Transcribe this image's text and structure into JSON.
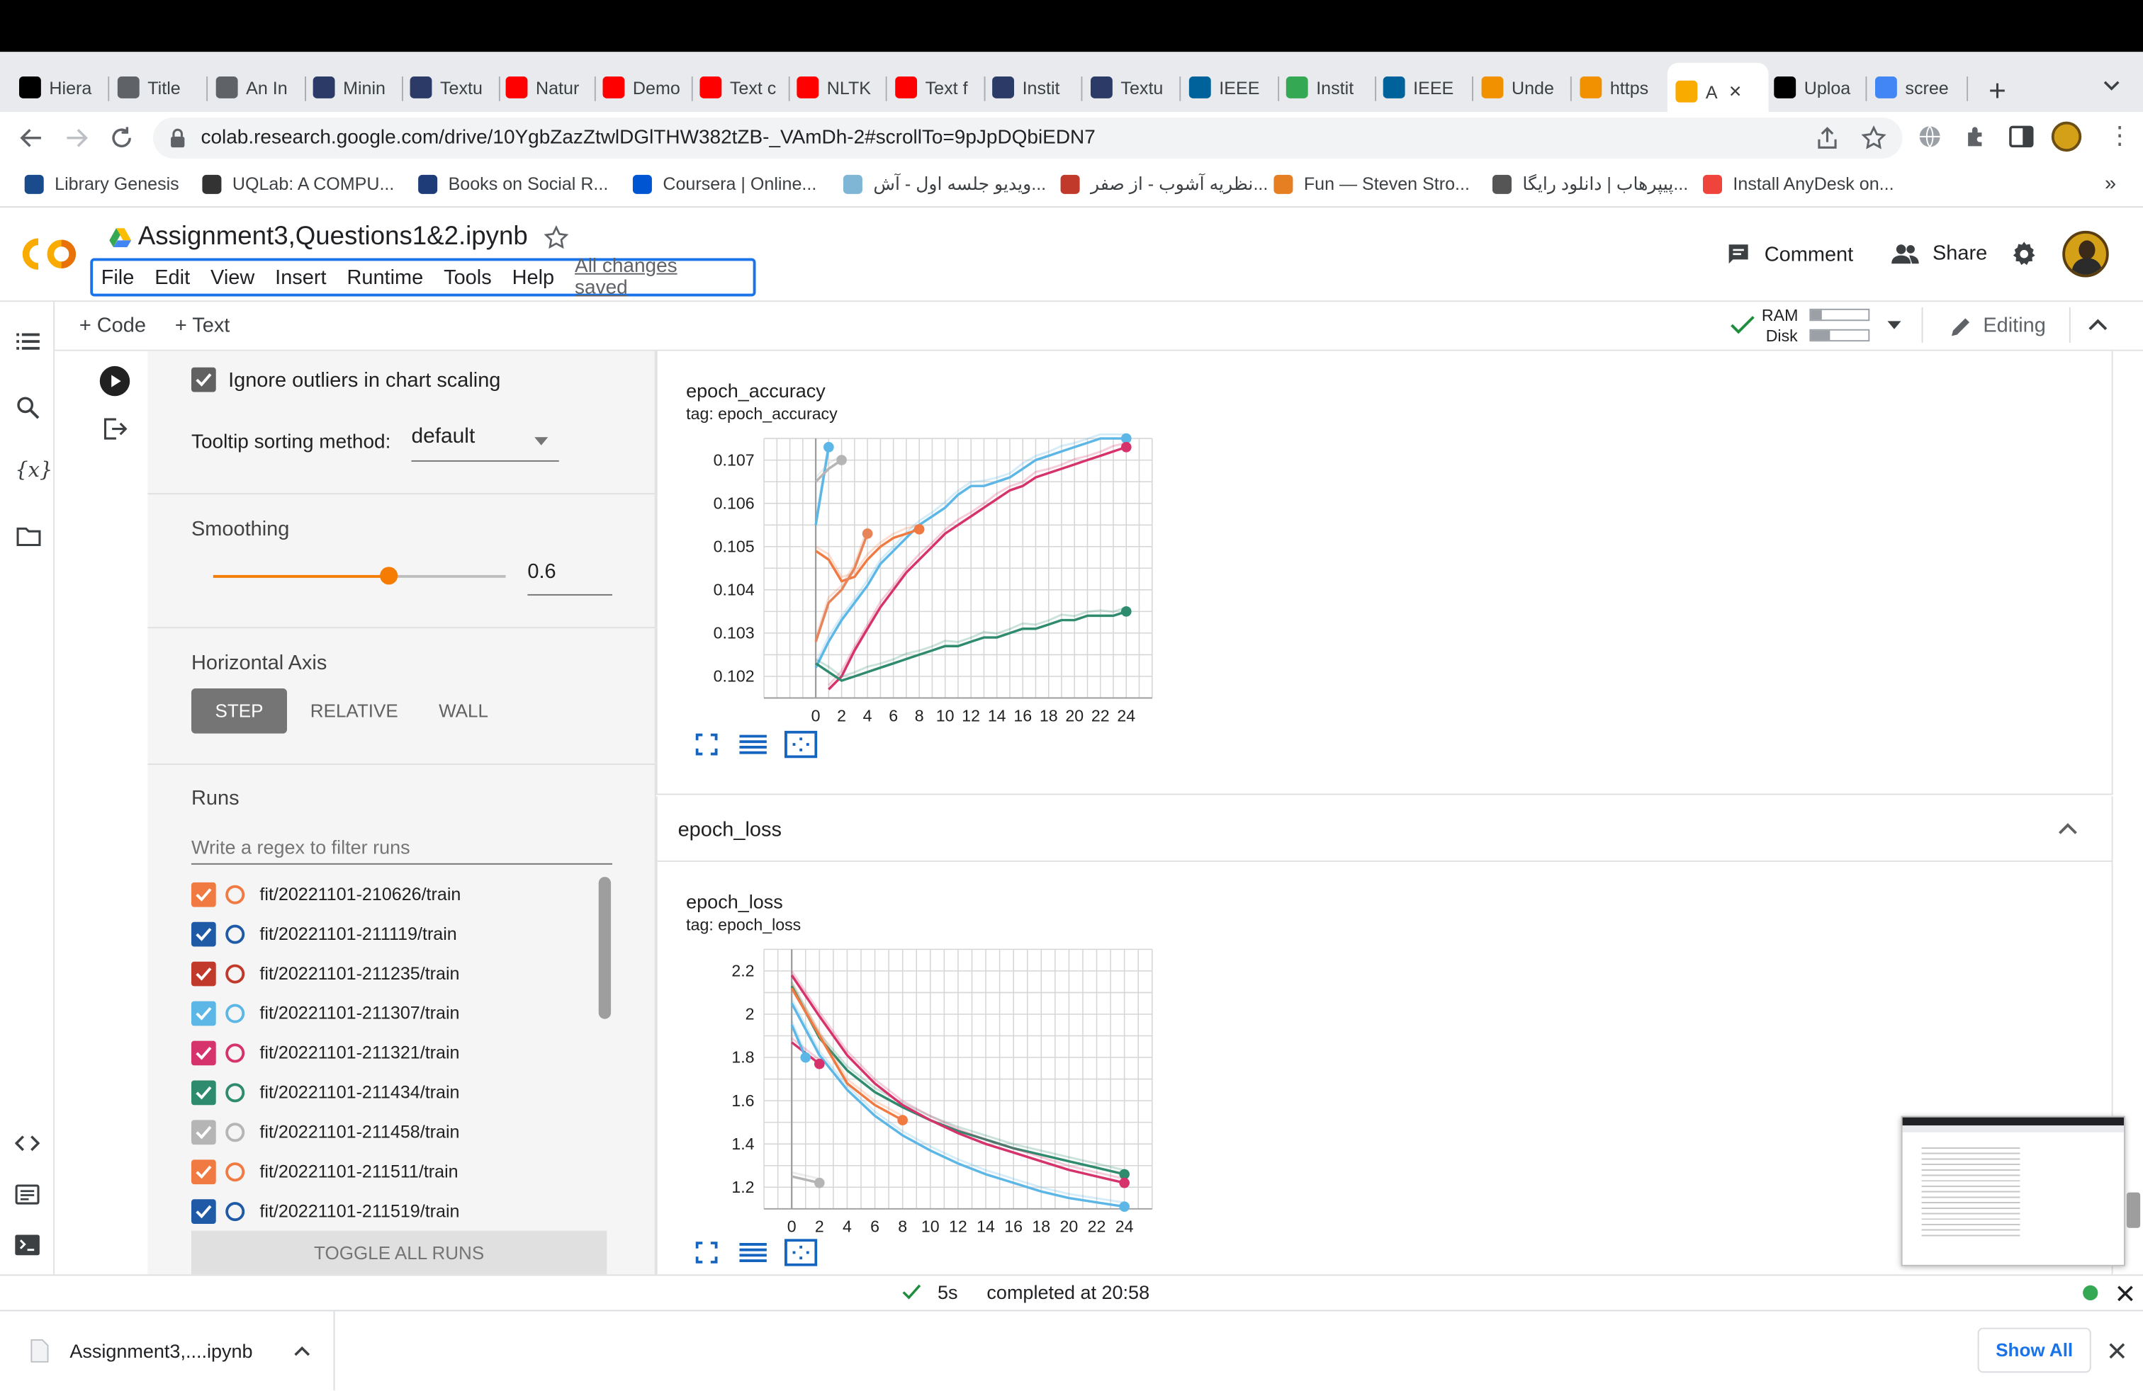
{
  "browser": {
    "tabs": [
      {
        "label": "Hiera",
        "icon": "asu-icon",
        "color": "#000"
      },
      {
        "label": "Title",
        "icon": "globe-icon",
        "color": "#5f6368"
      },
      {
        "label": "An In",
        "icon": "globe-icon",
        "color": "#5f6368"
      },
      {
        "label": "Minin",
        "icon": "arc-icon",
        "color": "#2b3a67"
      },
      {
        "label": "Textu",
        "icon": "arc-icon",
        "color": "#2b3a67"
      },
      {
        "label": "Natur",
        "icon": "youtube-icon",
        "color": "#ff0000"
      },
      {
        "label": "Demo",
        "icon": "youtube-icon",
        "color": "#ff0000"
      },
      {
        "label": "Text c",
        "icon": "youtube-icon",
        "color": "#ff0000"
      },
      {
        "label": "NLTK",
        "icon": "youtube-icon",
        "color": "#ff0000"
      },
      {
        "label": "Text f",
        "icon": "youtube-icon",
        "color": "#ff0000"
      },
      {
        "label": "Instit",
        "icon": "arc-icon",
        "color": "#2b3a67"
      },
      {
        "label": "Textu",
        "icon": "arc-icon",
        "color": "#2b3a67"
      },
      {
        "label": "IEEE",
        "icon": "ieee-icon",
        "color": "#00629b"
      },
      {
        "label": "Instit",
        "icon": "chrome-icon",
        "color": "#34a853"
      },
      {
        "label": "IEEE",
        "icon": "ieee-icon",
        "color": "#00629b"
      },
      {
        "label": "Unde",
        "icon": "e-icon",
        "color": "#f29100"
      },
      {
        "label": "https",
        "icon": "e-icon",
        "color": "#f29100"
      },
      {
        "label": "A",
        "icon": "colab-icon",
        "color": "#f9ab00",
        "active": true
      },
      {
        "label": "Uploa",
        "icon": "github-icon",
        "color": "#000"
      },
      {
        "label": "scree",
        "icon": "google-icon",
        "color": "#4285f4"
      }
    ],
    "url": "colab.research.google.com/drive/10YgbZazZtwlDGlTHW382tZB-_VAmDh-2#scrollTo=9pJpDQbiEDN7",
    "bookmarks": [
      {
        "label": "Library Genesis",
        "color": "#1a4b8c"
      },
      {
        "label": "UQLab: A COMPU...",
        "color": "#333"
      },
      {
        "label": "Books on Social R...",
        "color": "#1d3c78"
      },
      {
        "label": "Coursera | Online...",
        "color": "#0056d2"
      },
      {
        "label": "ویدیو جلسه اول - آش...",
        "color": "#7fb6d6"
      },
      {
        "label": "نظریه آشوب - از صفر...",
        "color": "#c0392b"
      },
      {
        "label": "Fun — Steven Stro...",
        "color": "#e67e22"
      },
      {
        "label": "پیپرهاب | دانلود رایگا...",
        "color": "#555"
      },
      {
        "label": "Install AnyDesk on...",
        "color": "#ef443b"
      }
    ],
    "more_bookmarks": "»"
  },
  "colab": {
    "notebook_title": "Assignment3,Questions1&2.ipynb",
    "menu": [
      "File",
      "Edit",
      "View",
      "Insert",
      "Runtime",
      "Tools",
      "Help"
    ],
    "saved_status": "All changes saved",
    "comment_label": "Comment",
    "share_label": "Share",
    "add_code": "+ Code",
    "add_text": "+ Text",
    "ram_label": "RAM",
    "disk_label": "Disk",
    "editing_label": "Editing",
    "status_time": "5s",
    "status_text": "completed at 20:58"
  },
  "tensorboard": {
    "ignore_outliers_label": "Ignore outliers in chart scaling",
    "ignore_outliers_checked": true,
    "tooltip_sort_label": "Tooltip sorting method:",
    "tooltip_sort_value": "default",
    "smoothing_label": "Smoothing",
    "smoothing_value": "0.6",
    "smoothing_fraction": 0.6,
    "horizontal_axis_label": "Horizontal Axis",
    "axis_options": [
      "STEP",
      "RELATIVE",
      "WALL"
    ],
    "axis_selected": "STEP",
    "runs_label": "Runs",
    "runs_filter_placeholder": "Write a regex to filter runs",
    "toggle_all_label": "TOGGLE ALL RUNS",
    "runs": [
      {
        "name": "fit/20221101-210626/train",
        "color": "#f07a42"
      },
      {
        "name": "fit/20221101-211119/train",
        "color": "#1f5aa6"
      },
      {
        "name": "fit/20221101-211235/train",
        "color": "#c0392b"
      },
      {
        "name": "fit/20221101-211307/train",
        "color": "#5cb7e6"
      },
      {
        "name": "fit/20221101-211321/train",
        "color": "#d6336c"
      },
      {
        "name": "fit/20221101-211434/train",
        "color": "#2e8b6e"
      },
      {
        "name": "fit/20221101-211458/train",
        "color": "#b5b5b5"
      },
      {
        "name": "fit/20221101-211511/train",
        "color": "#f07a42"
      },
      {
        "name": "fit/20221101-211519/train",
        "color": "#1f5aa6"
      }
    ],
    "loss_section_header": "epoch_loss"
  },
  "downloads": {
    "file_name": "Assignment3,....ipynb",
    "show_all": "Show All"
  },
  "chart_data": [
    {
      "type": "line",
      "title": "epoch_accuracy",
      "subtitle": "tag: epoch_accuracy",
      "xticks": [
        0,
        2,
        4,
        6,
        8,
        10,
        12,
        14,
        16,
        18,
        20,
        22,
        24
      ],
      "yticks": [
        0.102,
        0.103,
        0.104,
        0.105,
        0.106,
        0.107
      ],
      "xlim": [
        -4,
        26
      ],
      "ylim": [
        0.1015,
        0.1075
      ],
      "grid": true,
      "series": [
        {
          "color": "#5cb7e6",
          "x": [
            0,
            1,
            2,
            3,
            4,
            5,
            6,
            7,
            8,
            9,
            10,
            11,
            12,
            13,
            14,
            15,
            16,
            17,
            18,
            19,
            20,
            21,
            22,
            23,
            24
          ],
          "y": [
            0.1022,
            0.1028,
            0.1033,
            0.1037,
            0.1041,
            0.1046,
            0.1049,
            0.1052,
            0.1055,
            0.1057,
            0.1059,
            0.1062,
            0.1064,
            0.1064,
            0.1065,
            0.1066,
            0.1068,
            0.107,
            0.1071,
            0.1072,
            0.1073,
            0.1074,
            0.1075,
            0.1076,
            0.1078
          ]
        },
        {
          "color": "#d6336c",
          "x": [
            1,
            2,
            3,
            4,
            5,
            6,
            7,
            8,
            9,
            10,
            11,
            12,
            13,
            14,
            15,
            16,
            17,
            18,
            19,
            20,
            21,
            22,
            23,
            24
          ],
          "y": [
            0.1017,
            0.102,
            0.1026,
            0.1031,
            0.1036,
            0.104,
            0.1044,
            0.1047,
            0.105,
            0.1053,
            0.1055,
            0.1057,
            0.1059,
            0.1061,
            0.1063,
            0.1064,
            0.1066,
            0.1067,
            0.1068,
            0.1069,
            0.107,
            0.1071,
            0.1072,
            0.1073
          ]
        },
        {
          "color": "#2e8b6e",
          "x": [
            0,
            1,
            2,
            3,
            4,
            5,
            6,
            7,
            8,
            9,
            10,
            11,
            12,
            13,
            14,
            15,
            16,
            17,
            18,
            19,
            20,
            21,
            22,
            23,
            24
          ],
          "y": [
            0.1023,
            0.1021,
            0.1019,
            0.102,
            0.1021,
            0.1022,
            0.1023,
            0.1024,
            0.1025,
            0.1026,
            0.1027,
            0.1027,
            0.1028,
            0.1029,
            0.1029,
            0.103,
            0.1031,
            0.1031,
            0.1032,
            0.1033,
            0.1033,
            0.1034,
            0.1034,
            0.1034,
            0.1035
          ]
        },
        {
          "color": "#f07a42",
          "x": [
            0,
            1,
            2,
            3,
            4,
            5,
            6,
            7,
            8
          ],
          "y": [
            0.1049,
            0.1047,
            0.1042,
            0.1043,
            0.1047,
            0.105,
            0.1052,
            0.1053,
            0.1054
          ]
        },
        {
          "color": "#e8845a",
          "x": [
            0,
            1,
            2,
            3,
            4
          ],
          "y": [
            0.1028,
            0.1037,
            0.104,
            0.1045,
            0.1053
          ]
        },
        {
          "color": "#5cb7e6",
          "x": [
            0,
            1
          ],
          "y": [
            0.1055,
            0.1073
          ]
        },
        {
          "color": "#b5b5b5",
          "x": [
            0,
            1,
            2
          ],
          "y": [
            0.1065,
            0.1068,
            0.107
          ]
        }
      ]
    },
    {
      "type": "line",
      "title": "epoch_loss",
      "subtitle": "tag: epoch_loss",
      "xticks": [
        0,
        2,
        4,
        6,
        8,
        10,
        12,
        14,
        16,
        18,
        20,
        22,
        24
      ],
      "yticks": [
        1.2,
        1.4,
        1.6,
        1.8,
        2,
        2.2
      ],
      "xlim": [
        -2,
        26
      ],
      "ylim": [
        1.1,
        2.3
      ],
      "grid": true,
      "series": [
        {
          "color": "#2e8b6e",
          "x": [
            0,
            2,
            4,
            6,
            8,
            10,
            12,
            14,
            16,
            18,
            20,
            22,
            24
          ],
          "y": [
            2.13,
            1.89,
            1.74,
            1.64,
            1.57,
            1.51,
            1.46,
            1.42,
            1.38,
            1.35,
            1.32,
            1.29,
            1.26
          ]
        },
        {
          "color": "#d6336c",
          "x": [
            0,
            2,
            4,
            6,
            8,
            10,
            12,
            14,
            16,
            18,
            20,
            22,
            24
          ],
          "y": [
            2.18,
            1.99,
            1.81,
            1.68,
            1.58,
            1.51,
            1.45,
            1.4,
            1.36,
            1.32,
            1.28,
            1.25,
            1.22
          ]
        },
        {
          "color": "#5cb7e6",
          "x": [
            0,
            2,
            4,
            6,
            8,
            10,
            12,
            14,
            16,
            18,
            20,
            22,
            24
          ],
          "y": [
            2.05,
            1.81,
            1.65,
            1.53,
            1.44,
            1.37,
            1.31,
            1.26,
            1.22,
            1.18,
            1.15,
            1.13,
            1.11
          ]
        },
        {
          "color": "#f07a42",
          "x": [
            0,
            2,
            4,
            6,
            8
          ],
          "y": [
            2.12,
            1.9,
            1.68,
            1.58,
            1.51
          ]
        },
        {
          "color": "#d6336c",
          "x": [
            0,
            1,
            2
          ],
          "y": [
            1.87,
            1.82,
            1.77
          ]
        },
        {
          "color": "#5cb7e6",
          "x": [
            0,
            1
          ],
          "y": [
            1.95,
            1.8
          ]
        },
        {
          "color": "#b5b5b5",
          "x": [
            0,
            2
          ],
          "y": [
            1.25,
            1.22
          ]
        }
      ]
    }
  ]
}
